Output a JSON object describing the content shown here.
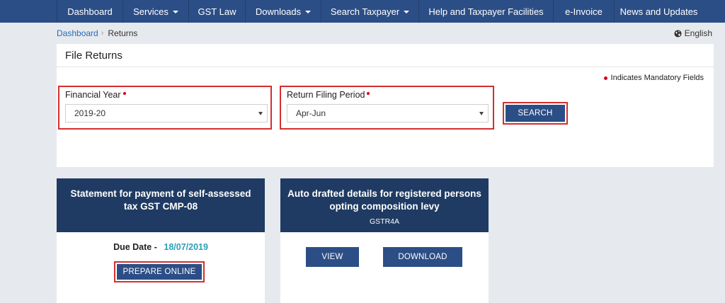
{
  "nav": {
    "items": [
      {
        "label": "Dashboard",
        "dropdown": false
      },
      {
        "label": "Services",
        "dropdown": true
      },
      {
        "label": "GST Law",
        "dropdown": false
      },
      {
        "label": "Downloads",
        "dropdown": true
      },
      {
        "label": "Search Taxpayer",
        "dropdown": true
      },
      {
        "label": "Help and Taxpayer Facilities",
        "dropdown": false
      },
      {
        "label": "e-Invoice",
        "dropdown": false
      },
      {
        "label": "News and Updates",
        "dropdown": false
      }
    ]
  },
  "breadcrumb": {
    "home": "Dashboard",
    "separator": "›",
    "current": "Returns"
  },
  "language": {
    "label": "English",
    "icon": "globe-icon"
  },
  "file_returns": {
    "title": "File Returns",
    "mandatory_note": "Indicates Mandatory Fields",
    "financial_year": {
      "label": "Financial Year",
      "value": "2019-20"
    },
    "return_period": {
      "label": "Return Filing Period",
      "value": "Apr-Jun"
    },
    "search_label": "SEARCH"
  },
  "cards": {
    "cmp08": {
      "title": "Statement for payment of self-assessed tax GST CMP-08",
      "due_label": "Due Date -",
      "due_value": "18/07/2019",
      "prepare_label": "PREPARE ONLINE"
    },
    "gstr4a": {
      "title": "Auto drafted details for registered persons opting composition levy",
      "subtitle": "GSTR4A",
      "view_label": "VIEW",
      "download_label": "DOWNLOAD"
    }
  },
  "colors": {
    "nav_bg": "#2c4e86",
    "card_header": "#1f3b63",
    "button": "#2c4e86",
    "highlight_border": "#d32f2f",
    "due_date": "#2aa0b8",
    "required_dot": "#d0021b"
  }
}
